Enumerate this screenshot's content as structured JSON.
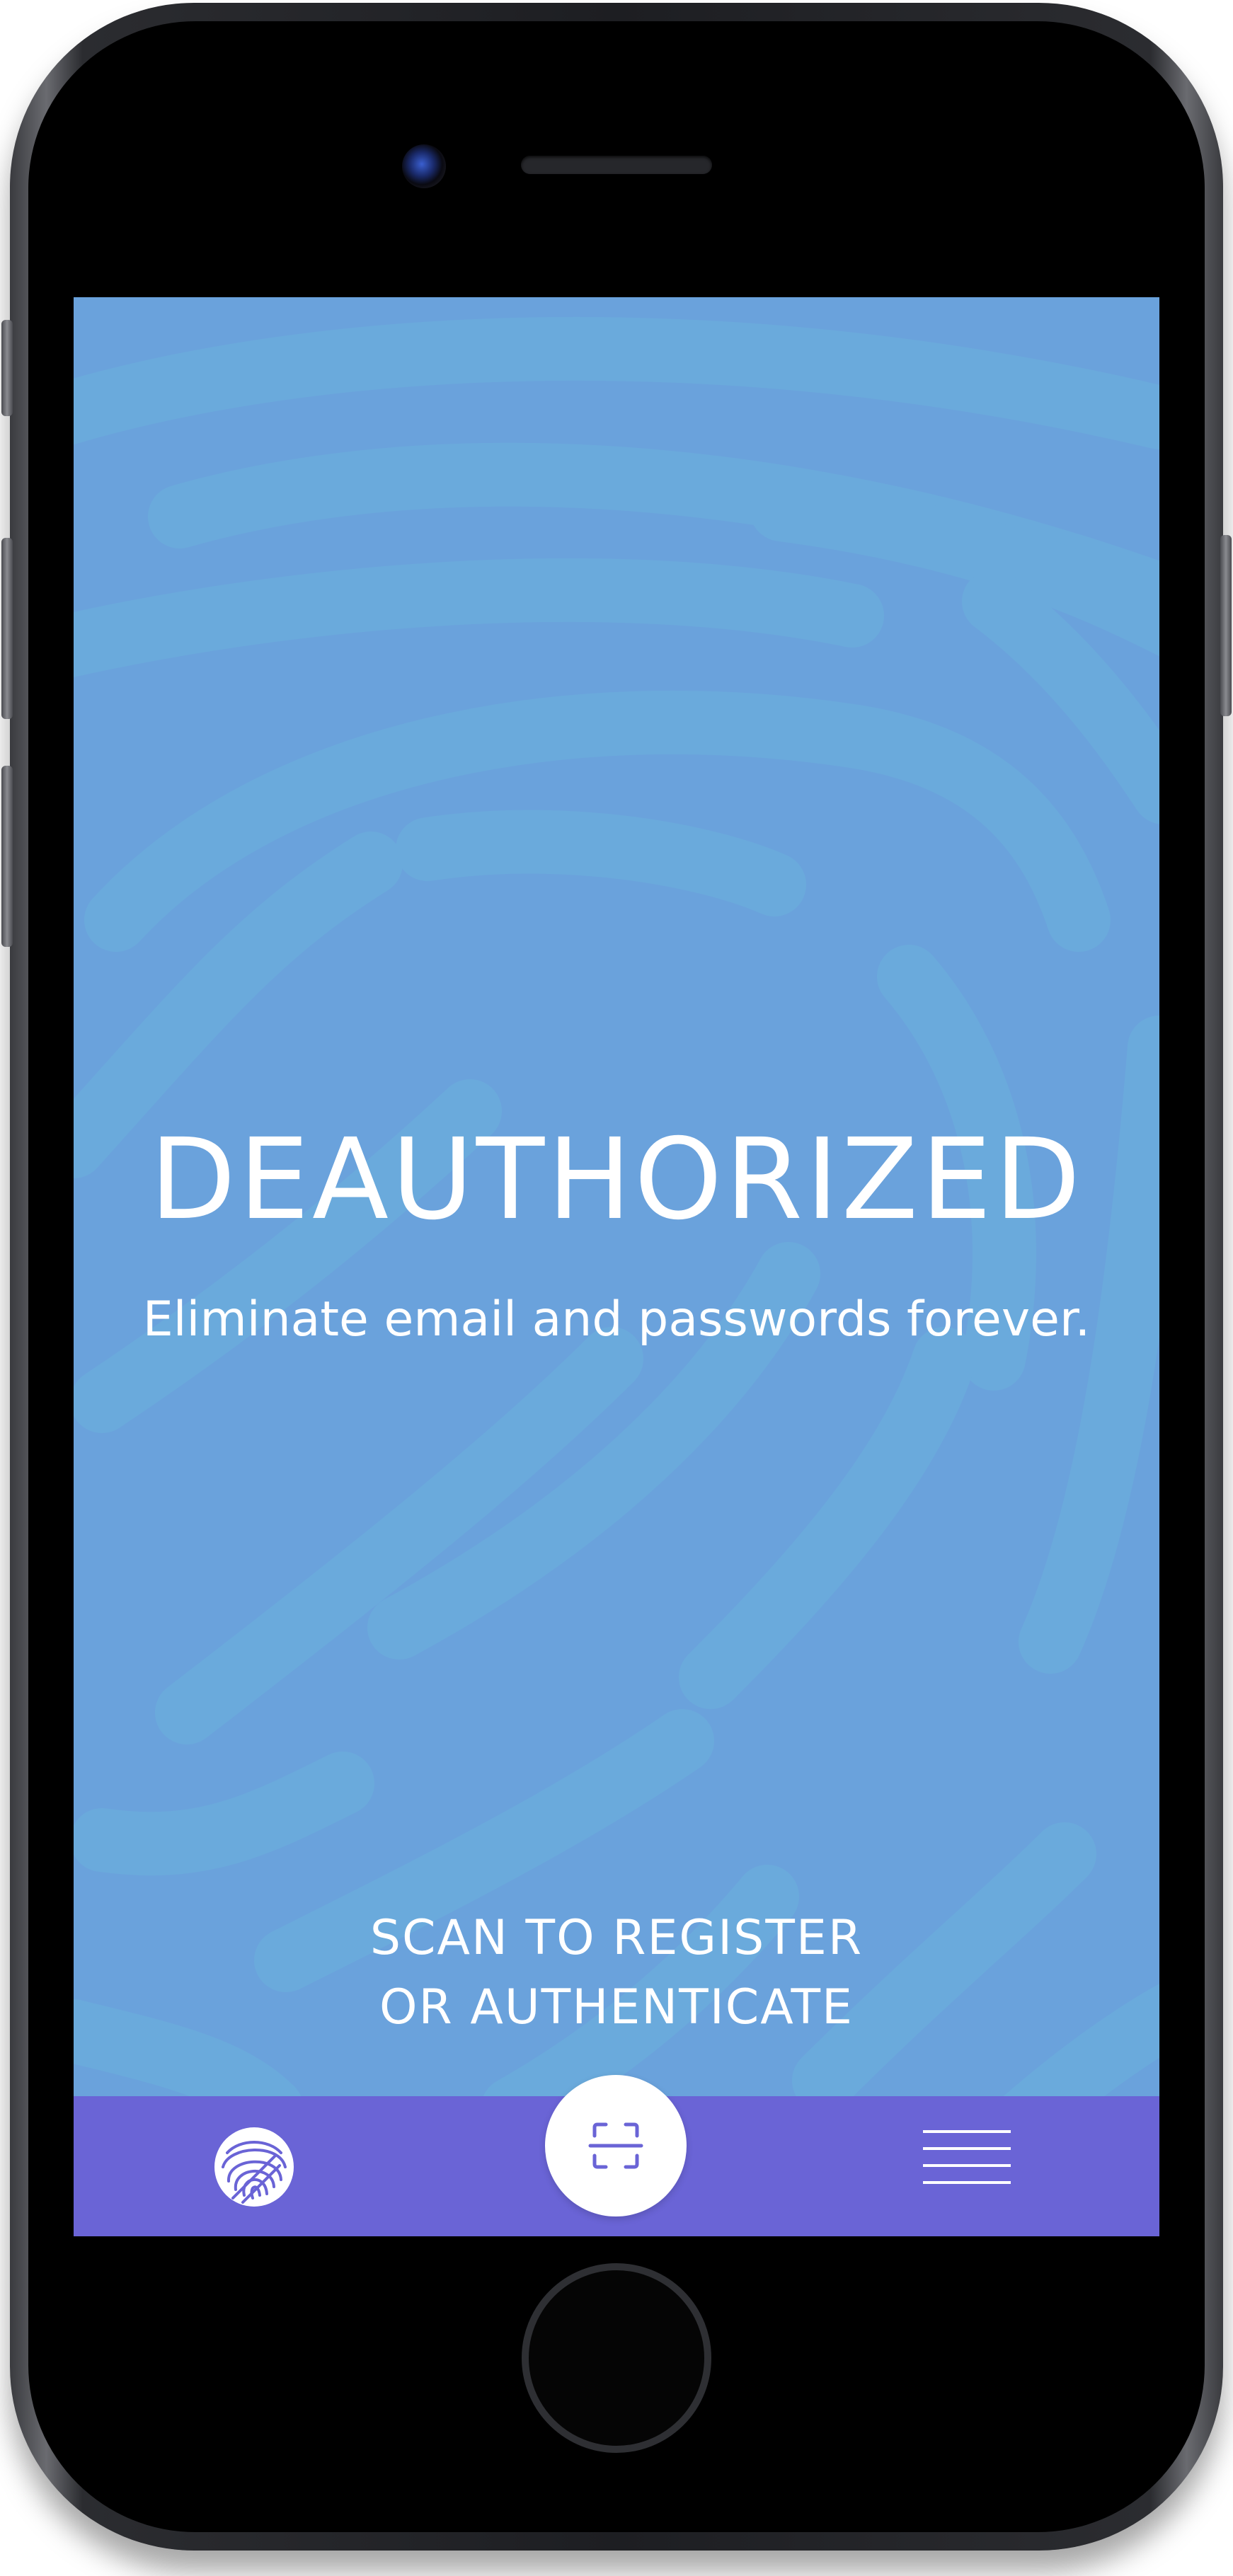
{
  "app": {
    "title": "DEAUTHORIZED",
    "tagline": "Eliminate email and passwords forever.",
    "scan_line1": "SCAN TO REGISTER",
    "scan_line2": "OR AUTHENTICATE"
  },
  "tabbar": {
    "items": [
      {
        "icon": "fingerprint-icon"
      },
      {
        "icon": "scan-icon"
      },
      {
        "icon": "menu-icon"
      }
    ]
  },
  "colors": {
    "screen_background": "#6aa2dc",
    "pattern": "#6ba9dd",
    "tabbar": "#6a64d6",
    "scan_icon": "#6a64d6",
    "text": "#ffffff"
  }
}
